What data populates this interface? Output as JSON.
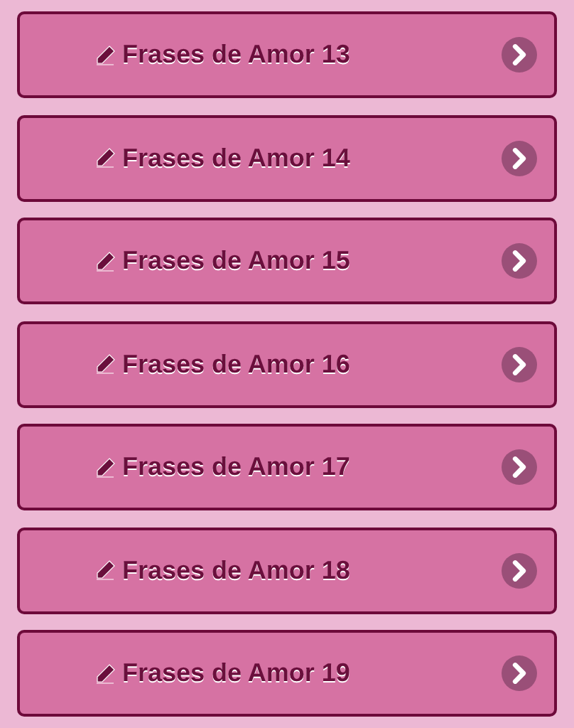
{
  "items": [
    {
      "label": "Frases de Amor 13"
    },
    {
      "label": "Frases de Amor 14"
    },
    {
      "label": "Frases de Amor 15"
    },
    {
      "label": "Frases de Amor 16"
    },
    {
      "label": "Frases de Amor 17"
    },
    {
      "label": "Frases de Amor 18"
    },
    {
      "label": "Frases de Amor 19"
    }
  ]
}
